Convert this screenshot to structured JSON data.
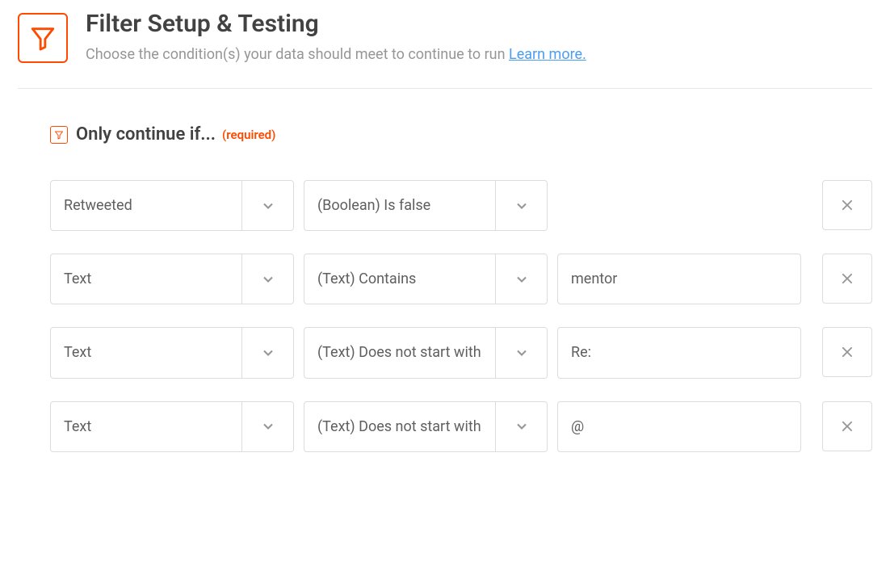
{
  "header": {
    "title": "Filter Setup & Testing",
    "subtitle_prefix": "Choose the condition(s) your data should meet to continue to run ",
    "learn_more": "Learn more."
  },
  "section": {
    "heading": "Only continue if...",
    "required": "(required)"
  },
  "rules": [
    {
      "subject": "Retweeted",
      "condition": "(Boolean) Is false",
      "value": null
    },
    {
      "subject": "Text",
      "condition": "(Text) Contains",
      "value": "mentor"
    },
    {
      "subject": "Text",
      "condition": "(Text) Does not start with",
      "value": "Re:"
    },
    {
      "subject": "Text",
      "condition": "(Text) Does not start with",
      "value": "@"
    }
  ]
}
